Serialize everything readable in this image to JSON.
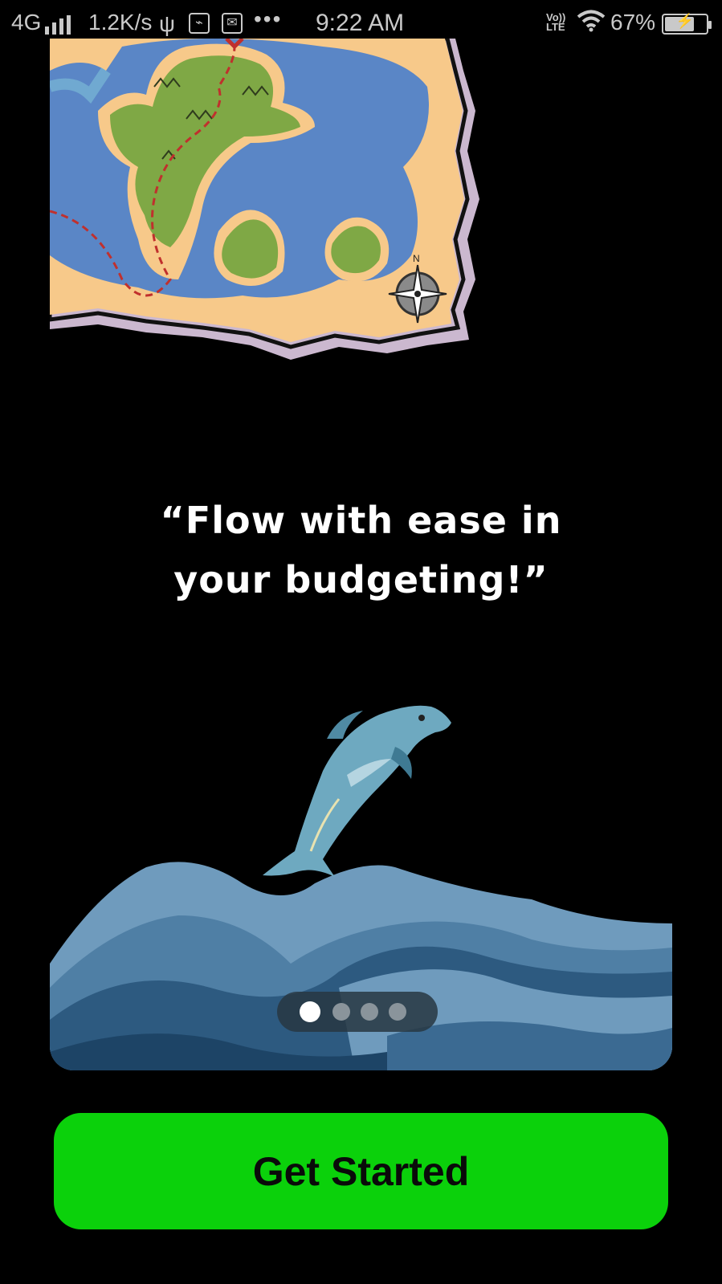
{
  "status_bar": {
    "network": "4G",
    "speed": "1.2K/s",
    "usb_symbol": "ψ",
    "dots": "•••",
    "time": "9:22 AM",
    "volte_line1": "Vo))",
    "volte_line2": "LTE",
    "battery_text": "67%",
    "battery_level": 0.67,
    "battery_bolt": "⚡"
  },
  "map": {
    "compass_letter": "N"
  },
  "quote": {
    "line1": "“Flow with ease in",
    "line2": "your budgeting!”"
  },
  "pager": {
    "count": 4,
    "active_index": 0
  },
  "actions": {
    "get_started_label": "Get Started"
  },
  "colors": {
    "background": "#000000",
    "button": "#0bd10b",
    "ocean": "#5a86c6",
    "sand": "#f7c98a",
    "land": "#7fa845",
    "waves": "#6f9bbd",
    "dolphin": "#6ea9c0"
  }
}
